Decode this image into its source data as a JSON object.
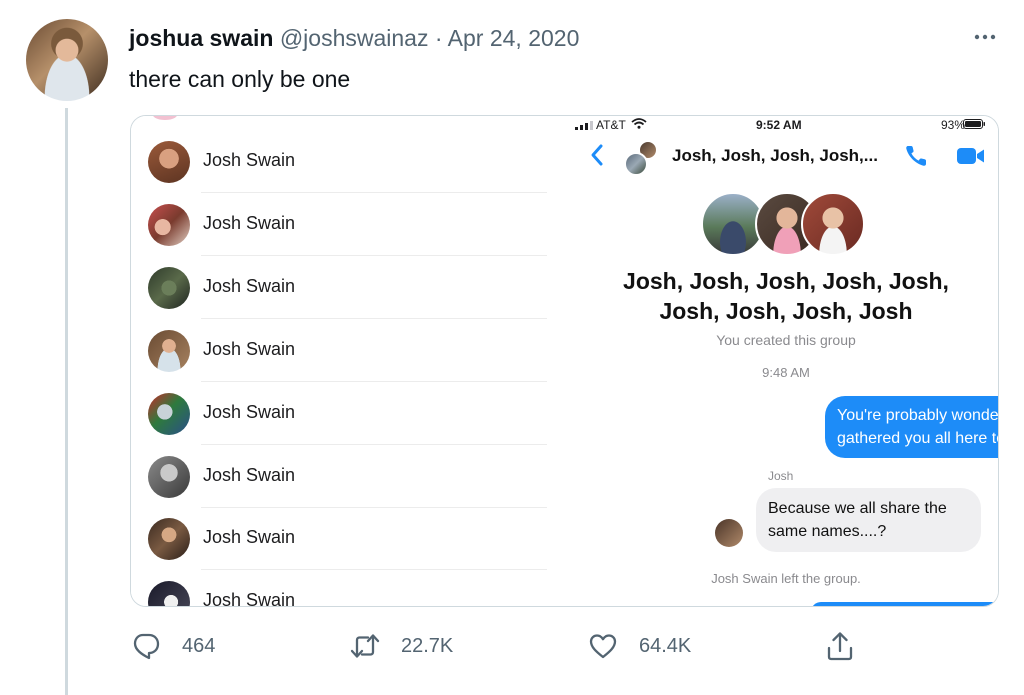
{
  "tweet": {
    "author_name": "joshua swain",
    "handle": "@joshswainaz",
    "separator": "·",
    "date": "Apr 24, 2020",
    "text": "there can only be one"
  },
  "contacts": [
    {
      "name": "Josh Swain"
    },
    {
      "name": "Josh Swain"
    },
    {
      "name": "Josh Swain"
    },
    {
      "name": "Josh Swain"
    },
    {
      "name": "Josh Swain"
    },
    {
      "name": "Josh Swain"
    },
    {
      "name": "Josh Swain"
    },
    {
      "name": "Josh Swain"
    }
  ],
  "messenger": {
    "status": {
      "carrier": "AT&T",
      "time": "9:52 AM",
      "battery": "93%"
    },
    "nav_title": "Josh, Josh, Josh, Josh,...",
    "group_title_line1": "Josh, Josh, Josh, Josh, Josh,",
    "group_title_line2": "Josh, Josh, Josh, Josh",
    "group_subtitle": "You created this group",
    "timestamp": "9:48 AM",
    "outgoing_message": "You're probably wondering why I've gathered you all here today",
    "sender_name": "Josh",
    "incoming_message": "Because we all share the same names....?",
    "system_note": "Josh Swain left the group."
  },
  "actions": {
    "replies": "464",
    "retweets": "22.7K",
    "likes": "64.4K"
  },
  "colors": {
    "accent": "#1d8cf8",
    "muted": "#536471",
    "divider": "#cfd9de"
  },
  "icons": {
    "more": "more-icon",
    "reply": "reply-icon",
    "retweet": "retweet-icon",
    "like": "heart-icon",
    "share": "share-icon"
  }
}
